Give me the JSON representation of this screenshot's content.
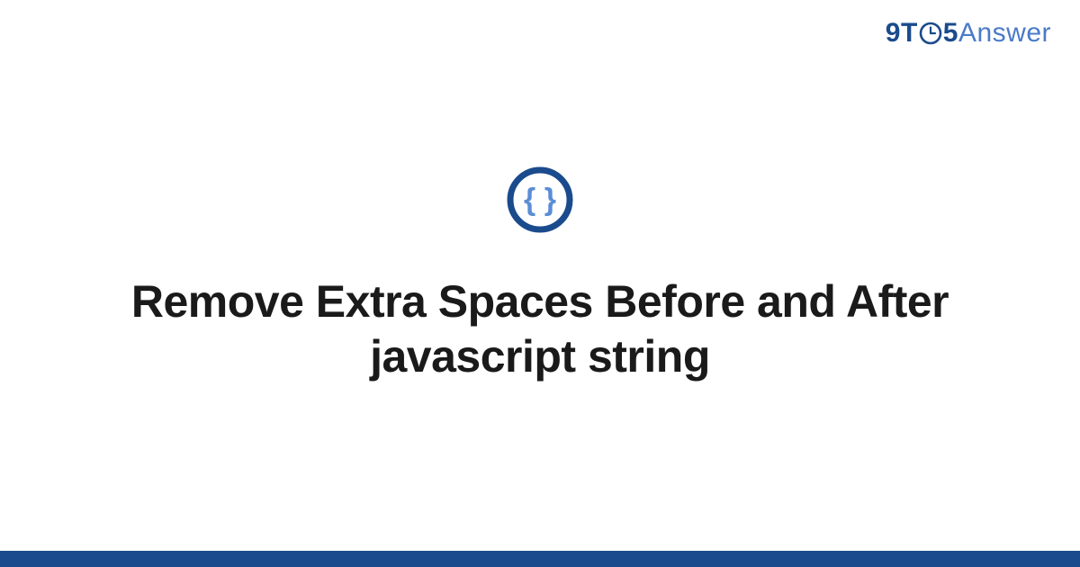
{
  "brand": {
    "part1": "9",
    "part2": "T",
    "part3_icon": "clock-icon",
    "part4": "5",
    "part5": "Answer"
  },
  "category_icon": "code-braces-icon",
  "title": "Remove Extra Spaces Before and After javascript string",
  "colors": {
    "brand_dark": "#1a4b8c",
    "brand_light": "#4a7bc8",
    "text": "#1a1a1a",
    "icon_inner": "#5b8dd6"
  }
}
